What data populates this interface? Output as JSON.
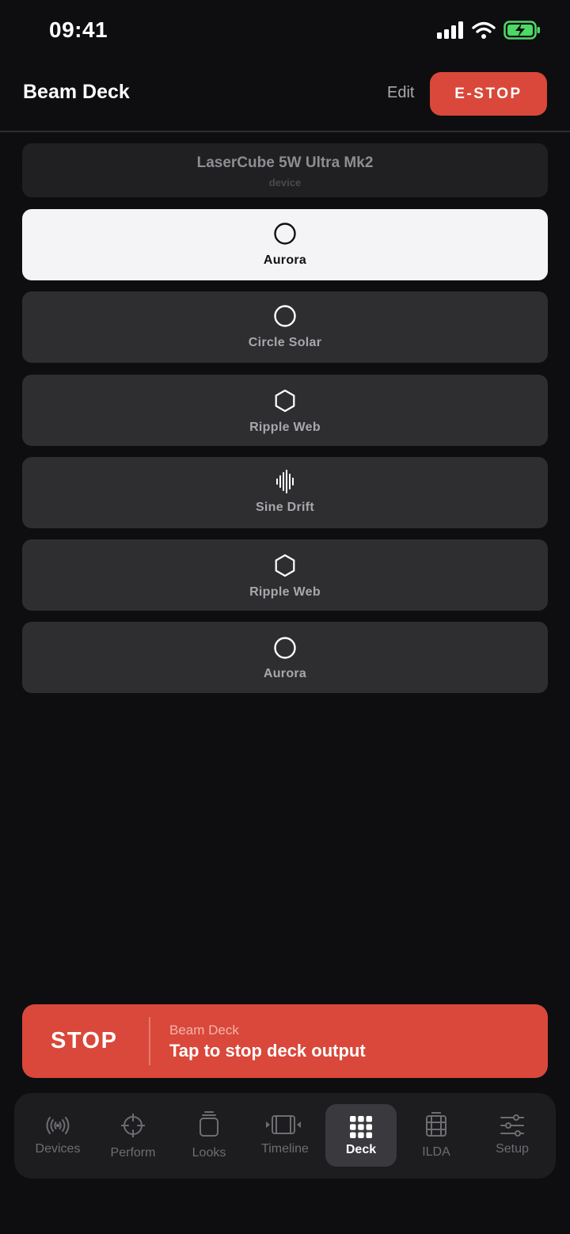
{
  "status_bar": {
    "time": "09:41"
  },
  "header": {
    "title": "Beam Deck",
    "edit_label": "Edit",
    "estop_label": "E-STOP"
  },
  "device": {
    "name": "LaserCube 5W Ultra Mk2",
    "subtitle": "device"
  },
  "deck_items": [
    {
      "label": "Aurora",
      "icon": "circle-icon",
      "active": true
    },
    {
      "label": "Circle Solar",
      "icon": "circle-icon",
      "active": false
    },
    {
      "label": "Ripple Web",
      "icon": "hexagon-icon",
      "active": false
    },
    {
      "label": "Sine Drift",
      "icon": "waveform-icon",
      "active": false
    },
    {
      "label": "Ripple Web",
      "icon": "hexagon-icon",
      "active": false
    },
    {
      "label": "Aurora",
      "icon": "circle-icon",
      "active": false
    }
  ],
  "stop_bar": {
    "stop_label": "STOP",
    "subtitle": "Beam Deck",
    "description": "Tap to stop deck output"
  },
  "tabs": [
    {
      "label": "Devices",
      "icon": "broadcast-icon"
    },
    {
      "label": "Perform",
      "icon": "crosshair-icon"
    },
    {
      "label": "Looks",
      "icon": "stack-icon"
    },
    {
      "label": "Timeline",
      "icon": "film-play-icon"
    },
    {
      "label": "Deck",
      "icon": "grid-icon",
      "active": true
    },
    {
      "label": "ILDA",
      "icon": "film-icon"
    },
    {
      "label": "Setup",
      "icon": "sliders-icon"
    }
  ],
  "colors": {
    "background": "#0e0e11",
    "accent_red": "#d9483a",
    "card": "#2e2e31",
    "card_active": "#f4f4f6"
  }
}
